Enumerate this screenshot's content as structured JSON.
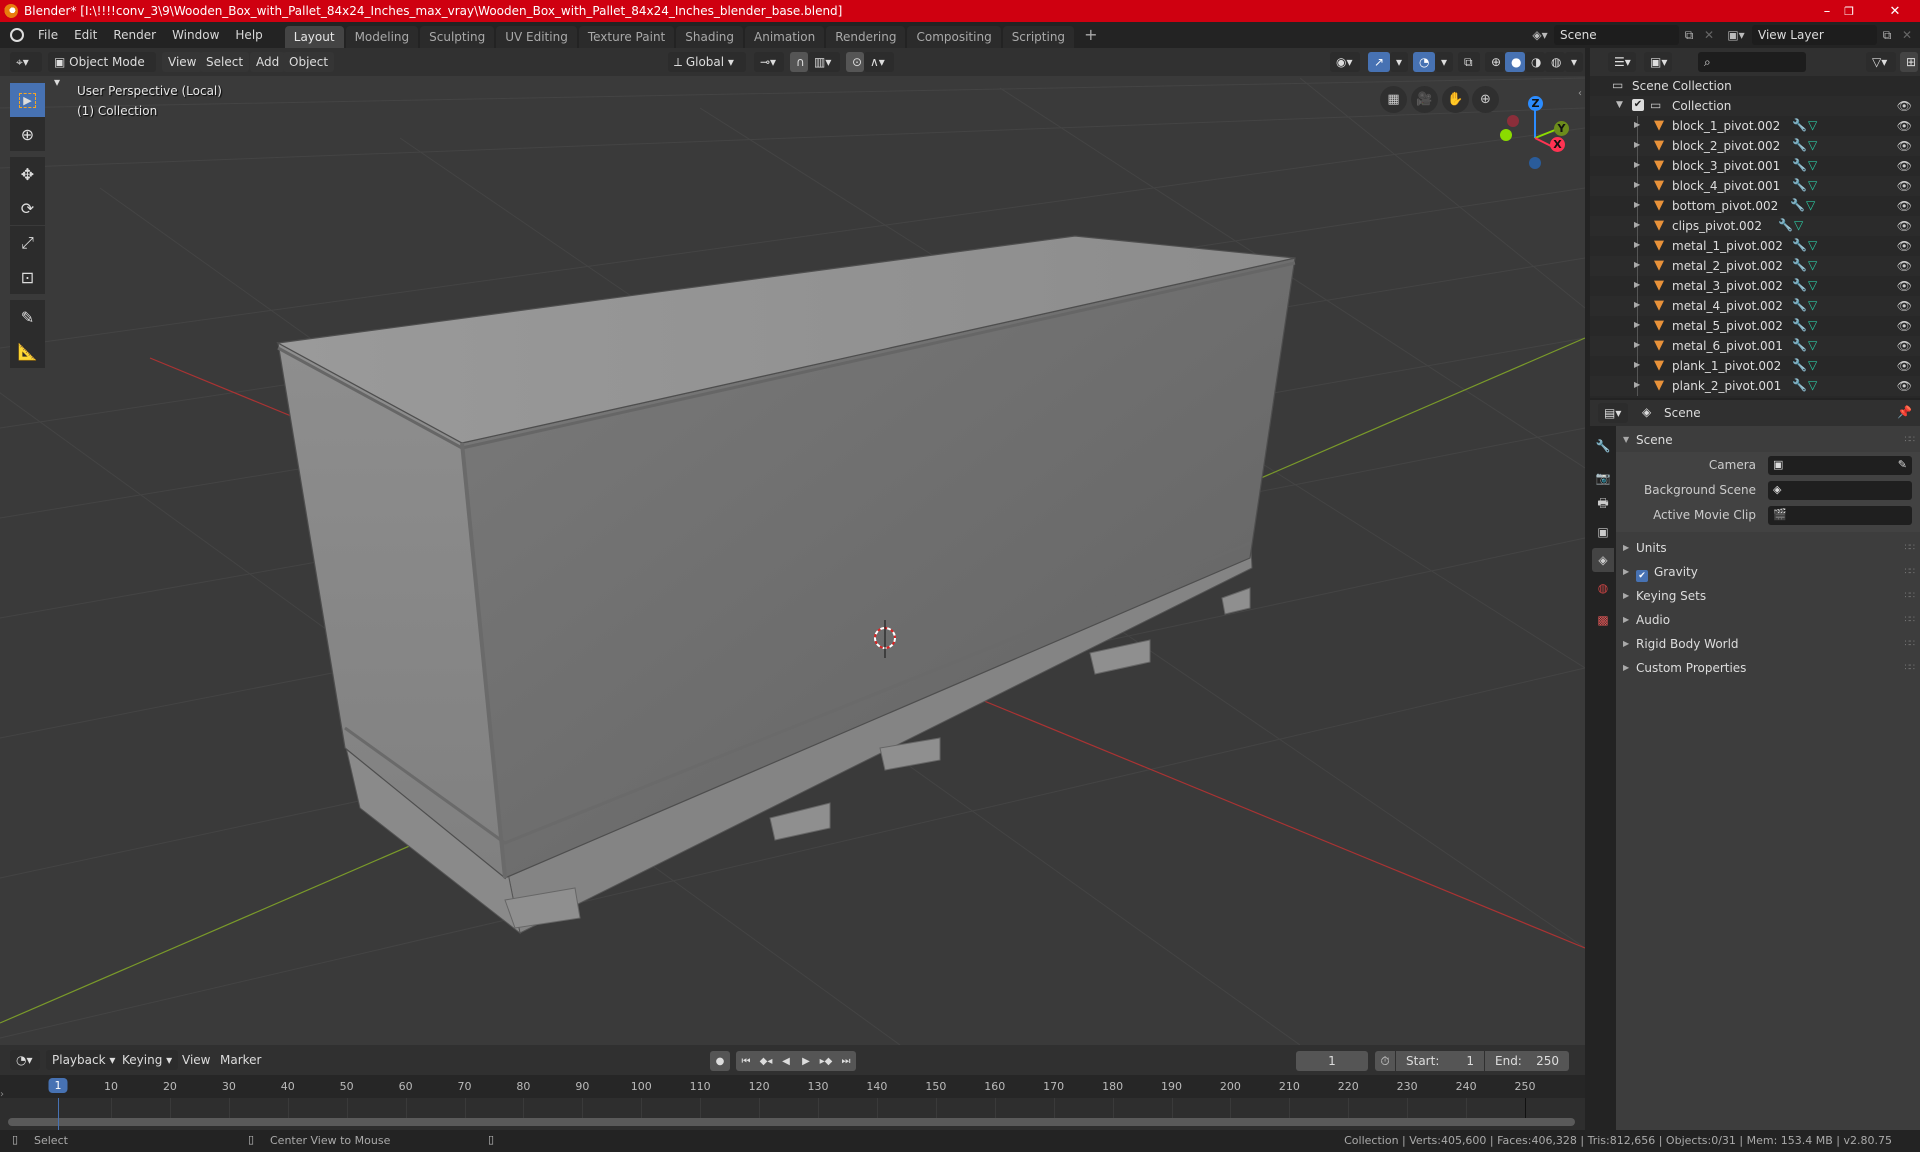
{
  "window": {
    "title": "Blender* [I:\\!!!!conv_3\\9\\Wooden_Box_with_Pallet_84x24_Inches_max_vray\\Wooden_Box_with_Pallet_84x24_Inches_blender_base.blend]",
    "minimize": "–",
    "maximize": "❐",
    "close": "✕"
  },
  "menu": [
    "File",
    "Edit",
    "Render",
    "Window",
    "Help"
  ],
  "workspaces": [
    {
      "label": "Layout",
      "active": true
    },
    {
      "label": "Modeling"
    },
    {
      "label": "Sculpting"
    },
    {
      "label": "UV Editing"
    },
    {
      "label": "Texture Paint"
    },
    {
      "label": "Shading"
    },
    {
      "label": "Animation"
    },
    {
      "label": "Rendering"
    },
    {
      "label": "Compositing"
    },
    {
      "label": "Scripting"
    }
  ],
  "add_workspace": "+",
  "scene_selector": {
    "value": "Scene"
  },
  "view_layer_selector": {
    "value": "View Layer"
  },
  "viewport_header": {
    "mode": "Object Mode",
    "menus": [
      "View",
      "Select",
      "Add",
      "Object"
    ],
    "transform_orientation": "Global"
  },
  "viewport": {
    "perspective_label": "User Perspective (Local)",
    "collection_label": "(1) Collection",
    "gizmo_axes": {
      "z": "Z",
      "y": "Y",
      "x": "X"
    },
    "axis_colors": {
      "x": "#ff3352",
      "y": "#8bdc00",
      "z": "#2b8cff"
    }
  },
  "outliner": {
    "search_placeholder": "",
    "root": "Scene Collection",
    "collection": "Collection",
    "items": [
      "block_1_pivot.002",
      "block_2_pivot.002",
      "block_3_pivot.001",
      "block_4_pivot.001",
      "bottom_pivot.002",
      "clips_pivot.002",
      "metal_1_pivot.002",
      "metal_2_pivot.002",
      "metal_3_pivot.002",
      "metal_4_pivot.002",
      "metal_5_pivot.002",
      "metal_6_pivot.001",
      "plank_1_pivot.002",
      "plank_2_pivot.001"
    ]
  },
  "properties": {
    "context": "Scene",
    "panel_scene": "Scene",
    "fields": [
      {
        "label": "Camera",
        "value": ""
      },
      {
        "label": "Background Scene",
        "value": ""
      },
      {
        "label": "Active Movie Clip",
        "value": ""
      }
    ],
    "panels": [
      {
        "label": "Units"
      },
      {
        "label": "Gravity",
        "checkbox": true,
        "checked": true
      },
      {
        "label": "Keying Sets"
      },
      {
        "label": "Audio"
      },
      {
        "label": "Rigid Body World"
      },
      {
        "label": "Custom Properties"
      }
    ]
  },
  "timeline": {
    "menus": [
      "Playback",
      "Keying",
      "View",
      "Marker"
    ],
    "current_frame": "1",
    "start_label": "Start:",
    "start": "1",
    "end_label": "End:",
    "end": "250",
    "ticks": [
      "1",
      "10",
      "20",
      "30",
      "40",
      "50",
      "60",
      "70",
      "80",
      "90",
      "100",
      "110",
      "120",
      "130",
      "140",
      "150",
      "160",
      "170",
      "180",
      "190",
      "200",
      "210",
      "220",
      "230",
      "240",
      "250"
    ]
  },
  "statusbar": {
    "left_action": "Select",
    "middle_action": "Center View to Mouse",
    "stats": "Collection | Verts:405,600 | Faces:406,328 | Tris:812,656 | Objects:0/31 | Mem: 153.4 MB | v2.80.75"
  }
}
